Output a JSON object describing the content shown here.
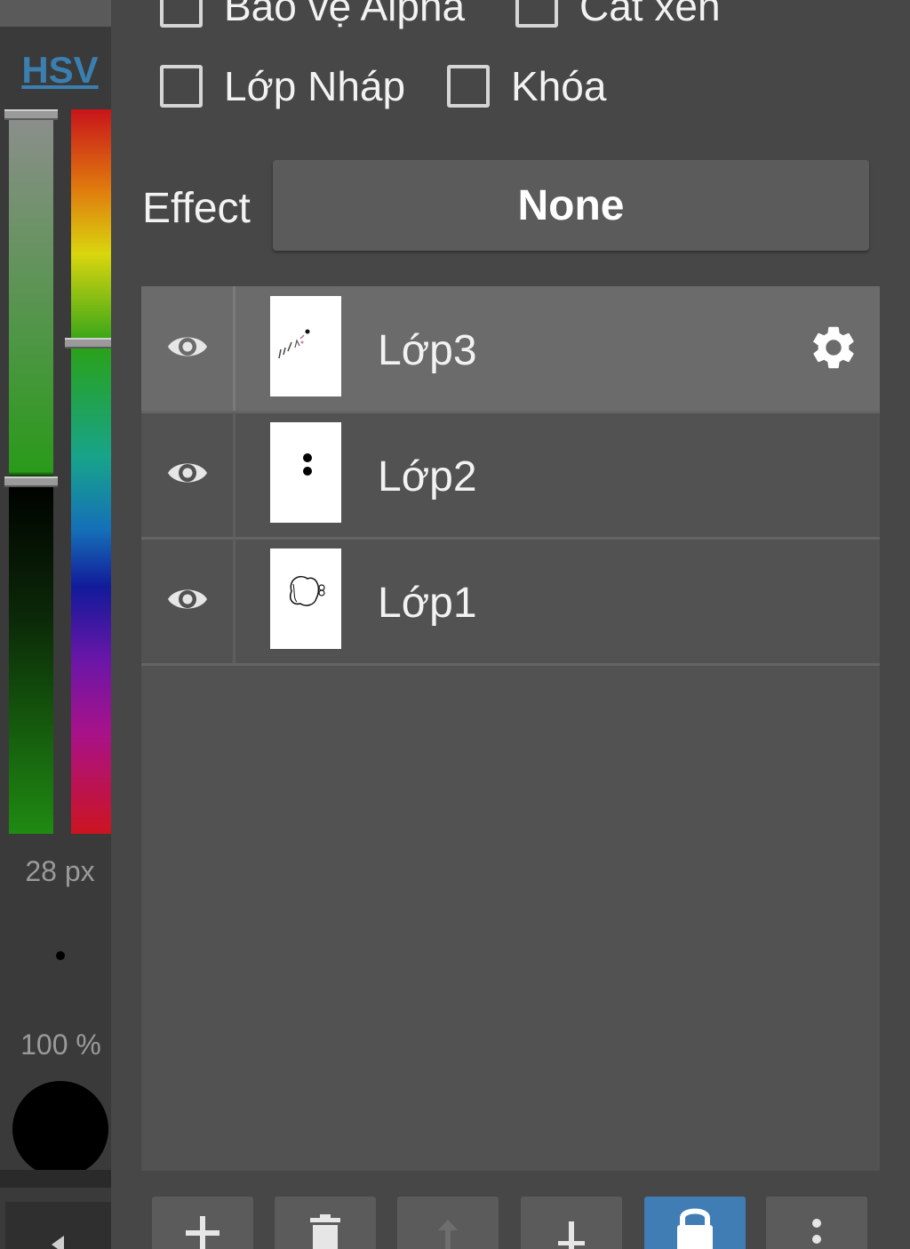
{
  "color_panel": {
    "mode_label": "HSV",
    "brush_size": "28 px",
    "opacity": "100 %",
    "current_color": "#000000"
  },
  "layer_options": {
    "alpha_protect_label": "Bảo vệ Alpha",
    "clipping_label": "Cắt xén",
    "draft_layer_label": "Lớp Nháp",
    "lock_label": "Khóa"
  },
  "effect": {
    "label": "Effect",
    "value": "None"
  },
  "layers": [
    {
      "name": "Lớp3",
      "visible": true,
      "selected": true
    },
    {
      "name": "Lớp2",
      "visible": true,
      "selected": false
    },
    {
      "name": "Lớp1",
      "visible": true,
      "selected": false
    }
  ],
  "toolbar": {
    "buttons": [
      "add-layer-icon",
      "delete-layer-icon",
      "move-layer-up-icon",
      "merge-layer-down-icon",
      "lock-icon",
      "more-options-icon"
    ],
    "active": "lock-icon",
    "accent": "#3f7db4"
  }
}
